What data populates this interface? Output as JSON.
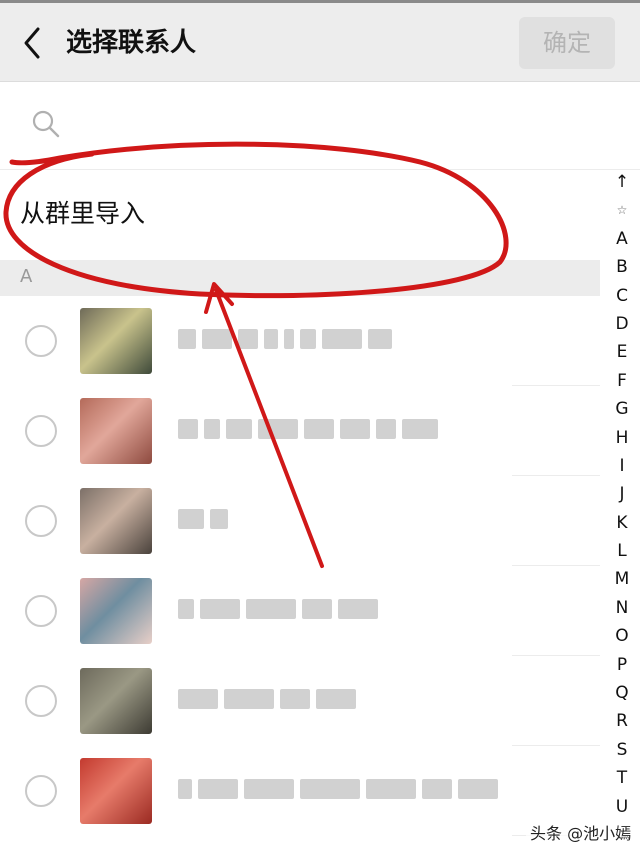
{
  "header": {
    "title": "选择联系人",
    "confirm_label": "确定",
    "back_icon": "chevron-left-icon"
  },
  "search": {
    "icon": "search-icon",
    "placeholder": "",
    "value": ""
  },
  "group_import": {
    "label": "从群里导入"
  },
  "section": {
    "letter": "A"
  },
  "contacts": [
    {
      "avatar_colors": [
        "#6e6a58",
        "#c9c38c",
        "#3f4a3a"
      ]
    },
    {
      "avatar_colors": [
        "#b46a5a",
        "#e1a79a",
        "#8e4a3f"
      ]
    },
    {
      "avatar_colors": [
        "#7c7068",
        "#c8b0a0",
        "#4a423c"
      ]
    },
    {
      "avatar_colors": [
        "#d6a7a4",
        "#6f8ea0",
        "#e8cfc8"
      ]
    },
    {
      "avatar_colors": [
        "#6d6a5c",
        "#9a9884",
        "#3d3b33"
      ]
    },
    {
      "avatar_colors": [
        "#c33a2f",
        "#e77b6a",
        "#9b2a22"
      ]
    }
  ],
  "index": {
    "items": [
      "↑",
      "☆",
      "A",
      "B",
      "C",
      "D",
      "E",
      "F",
      "G",
      "H",
      "I",
      "J",
      "K",
      "L",
      "M",
      "N",
      "O",
      "P",
      "Q",
      "R",
      "S",
      "T",
      "U"
    ]
  },
  "watermark": "头条 @池小嫣",
  "colors": {
    "header_bg": "#ededed",
    "annotation_red": "#d01818",
    "confirm_disabled": "#e0e0e0"
  }
}
